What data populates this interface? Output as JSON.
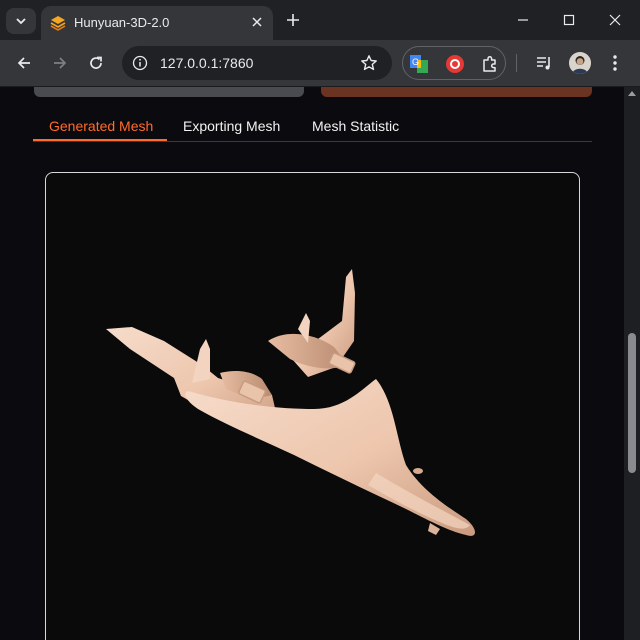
{
  "browser": {
    "tab_title": "Hunyuan-3D-2.0",
    "url": "127.0.0.1:7860",
    "icons": {
      "tab_search": "chevron-down-icon",
      "favicon": "hunyuan-layers-icon",
      "tab_close": "close-icon",
      "new_tab": "plus-icon",
      "minimize": "minimize-icon",
      "maximize": "maximize-icon",
      "close_window": "close-window-icon",
      "back": "arrow-left-icon",
      "forward": "arrow-right-icon",
      "reload": "reload-icon",
      "site_info": "info-icon",
      "bookmark": "star-icon",
      "extensions": "puzzle-icon",
      "media": "media-controls-icon",
      "menu": "kebab-menu-icon"
    }
  },
  "page": {
    "tabs": [
      {
        "label": "Generated Mesh",
        "active": true
      },
      {
        "label": "Exporting Mesh",
        "active": false
      },
      {
        "label": "Mesh Statistic",
        "active": false
      }
    ],
    "viewer": {
      "content": "3d-model-airplane",
      "background": "#0a0a0b"
    }
  },
  "colors": {
    "accent": "#ff6a2d",
    "chrome_dark": "#202124",
    "chrome_toolbar": "#35363a",
    "page_bg": "#0b0b0f"
  }
}
